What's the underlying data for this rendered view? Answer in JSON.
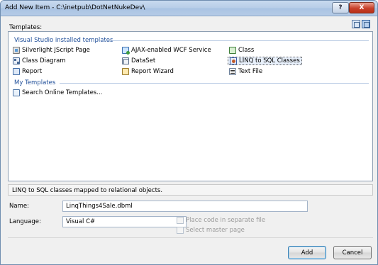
{
  "window": {
    "title": "Add New Item - C:\\inetpub\\DotNetNukeDev\\"
  },
  "titlebar_buttons": {
    "help": "?",
    "close": "X"
  },
  "templates_label": "Templates:",
  "view_icons": [
    "large-icons-view-icon",
    "small-icons-view-icon"
  ],
  "groups": {
    "installed": {
      "header": "Visual Studio installed templates",
      "items": [
        {
          "label": "Silverlight JScript Page",
          "icon": "jscript-page-icon"
        },
        {
          "label": "Class Diagram",
          "icon": "class-diagram-icon"
        },
        {
          "label": "Report",
          "icon": "report-icon"
        },
        {
          "label": "AJAX-enabled WCF Service",
          "icon": "wcf-service-icon"
        },
        {
          "label": "DataSet",
          "icon": "dataset-icon"
        },
        {
          "label": "Report Wizard",
          "icon": "report-wizard-icon"
        },
        {
          "label": "Class",
          "icon": "class-icon"
        },
        {
          "label": "LINQ to SQL Classes",
          "icon": "linq-to-sql-icon",
          "selected": true
        },
        {
          "label": "Text File",
          "icon": "text-file-icon"
        }
      ]
    },
    "my": {
      "header": "My Templates",
      "items": [
        {
          "label": "Search Online Templates...",
          "icon": "search-online-icon"
        }
      ]
    }
  },
  "description": "LINQ to SQL classes mapped to relational objects.",
  "form": {
    "name_label": "Name:",
    "name_value": "LinqThings4Sale.dbml",
    "language_label": "Language:",
    "language_value": "Visual C#",
    "place_code_label": "Place code in separate file",
    "master_page_label": "Select master page"
  },
  "buttons": {
    "add": "Add",
    "cancel": "Cancel"
  }
}
